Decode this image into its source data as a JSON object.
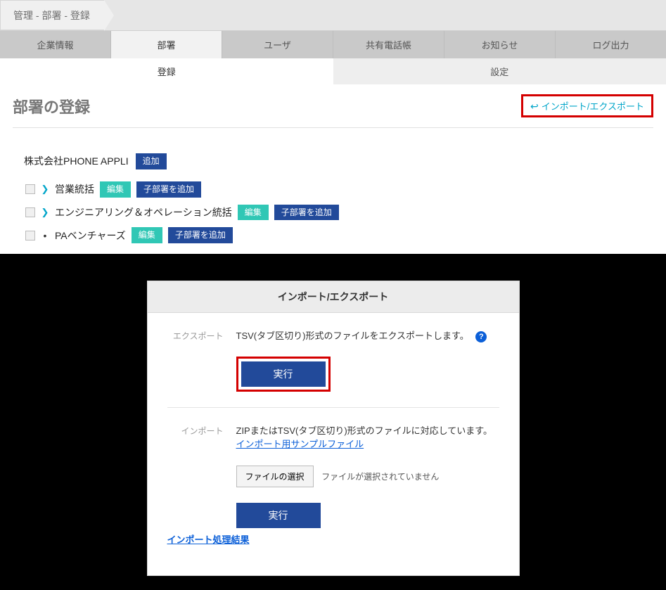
{
  "breadcrumb": {
    "text": "管理 - 部署 - 登録"
  },
  "tabs": {
    "main": [
      "企業情報",
      "部署",
      "ユーザ",
      "共有電話帳",
      "お知らせ",
      "ログ出力"
    ],
    "main_active_index": 1,
    "sub": [
      "登録",
      "設定"
    ],
    "sub_active_index": 0
  },
  "page": {
    "title": "部署の登録",
    "import_export_link": "インポート/エクスポート"
  },
  "tree": {
    "root_label": "株式会社PHONE APPLI",
    "root_add_btn": "追加",
    "edit_btn": "編集",
    "add_child_btn": "子部署を追加",
    "items": [
      {
        "label": "営業統括",
        "expandable": true
      },
      {
        "label": "エンジニアリング＆オペレーション統括",
        "expandable": true
      },
      {
        "label": "PAベンチャーズ",
        "expandable": false
      }
    ]
  },
  "panel": {
    "title": "インポート/エクスポート",
    "export": {
      "label": "エクスポート",
      "desc": "TSV(タブ区切り)形式のファイルをエクスポートします。",
      "exec_btn": "実行"
    },
    "import": {
      "label": "インポート",
      "desc": "ZIPまたはTSV(タブ区切り)形式のファイルに対応しています。",
      "sample_link": "インポート用サンプルファイル",
      "file_select_btn": "ファイルの選択",
      "no_file_text": "ファイルが選択されていません",
      "exec_btn": "実行",
      "result_link": "インポート処理結果"
    }
  }
}
